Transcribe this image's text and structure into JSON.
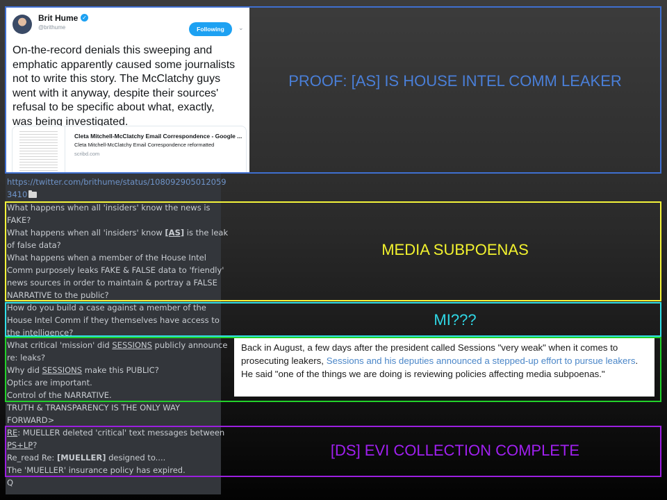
{
  "tweet": {
    "author_name": "Brit Hume",
    "handle": "@brithume",
    "follow_label": "Following",
    "text": "On-the-record denials this sweeping and\nemphatic apparently caused some journalists\nnot to write this story. The McClatchy guys\nwent with it anyway, despite their sources'\nrefusal to be specific about what, exactly,\nwas being investigated.",
    "link_card": {
      "title": "Cleta Mitchell-McClatchy Email Correspondence - Google ...",
      "subtitle": "Cleta Mitchell-McClatchy Email Correspondence reformatted",
      "domain": "scribd.com"
    }
  },
  "post": {
    "url_line1": "https://twitter.com/brithume/status/108092905012059",
    "url_line2": "3410",
    "q1_line1": "What happens when all 'insiders' know the news is",
    "q1_line2": "FAKE?",
    "q2_pre": "What happens when all 'insiders' know ",
    "q2_as": "[AS]",
    "q2_post": " is the leak",
    "q2_line2": "of false data?",
    "q3_line1": "What happens when a member of the House Intel",
    "q3_line2": "Comm purposely leaks FAKE & FALSE data to 'friendly'",
    "q3_line3": "news sources in order to maintain & portray a FALSE",
    "q3_line4": "NARRATIVE to the public?",
    "q4_line1": "How do you build a case against a member of the",
    "q4_line2": "House Intel Comm if they themselves have access to",
    "q4_line3": "the intelligence?",
    "m1_pre": "What critical 'mission' did ",
    "m1_sessions": "SESSIONS",
    "m1_post": " publicly announce",
    "m1_line2": "re: leaks?",
    "m2_pre": "Why did ",
    "m2_sessions": "SESSIONS",
    "m2_post": " make this PUBLIC?",
    "m3": "Optics are important.",
    "m4": "Control of the NARRATIVE.",
    "t1": "TRUTH & TRANSPARENCY IS THE ONLY WAY",
    "t2": "FORWARD>",
    "r1_re": "RE",
    "r1_post": ": MUELLER deleted 'critical' text messages between",
    "r1_ps": "PS+LP",
    "r1_q": "?",
    "r2_pre": "Re_read Re: ",
    "r2_mueller": "[MUELLER]",
    "r2_post": " designed to....",
    "r3": "The 'MUELLER' insurance policy has expired.",
    "sig": "Q"
  },
  "news": {
    "pre": "Back in August, a few days after the president called Sessions \"very weak\" when it comes to prosecuting leakers, ",
    "link": "Sessions and his deputies announced a stepped-up effort to pursue leakers",
    "post": ". He said \"one of the things we are doing is reviewing policies affecting media subpoenas.\""
  },
  "labels": {
    "proof": "PROOF: [AS] IS HOUSE INTEL COMM LEAKER",
    "media": "MEDIA SUBPOENAS",
    "mi": "MI???",
    "ds": "[DS] EVI COLLECTION COMPLETE"
  },
  "colors": {
    "blue": "#3f6fd0",
    "yellow": "#f5f53a",
    "cyan": "#32e0e8",
    "green": "#22d12a",
    "purple": "#9b1fe0",
    "proof_text": "#4a7fd8",
    "media_text": "#f2f22e",
    "mi_text": "#2fd8e6",
    "ds_text": "#a020f0"
  }
}
